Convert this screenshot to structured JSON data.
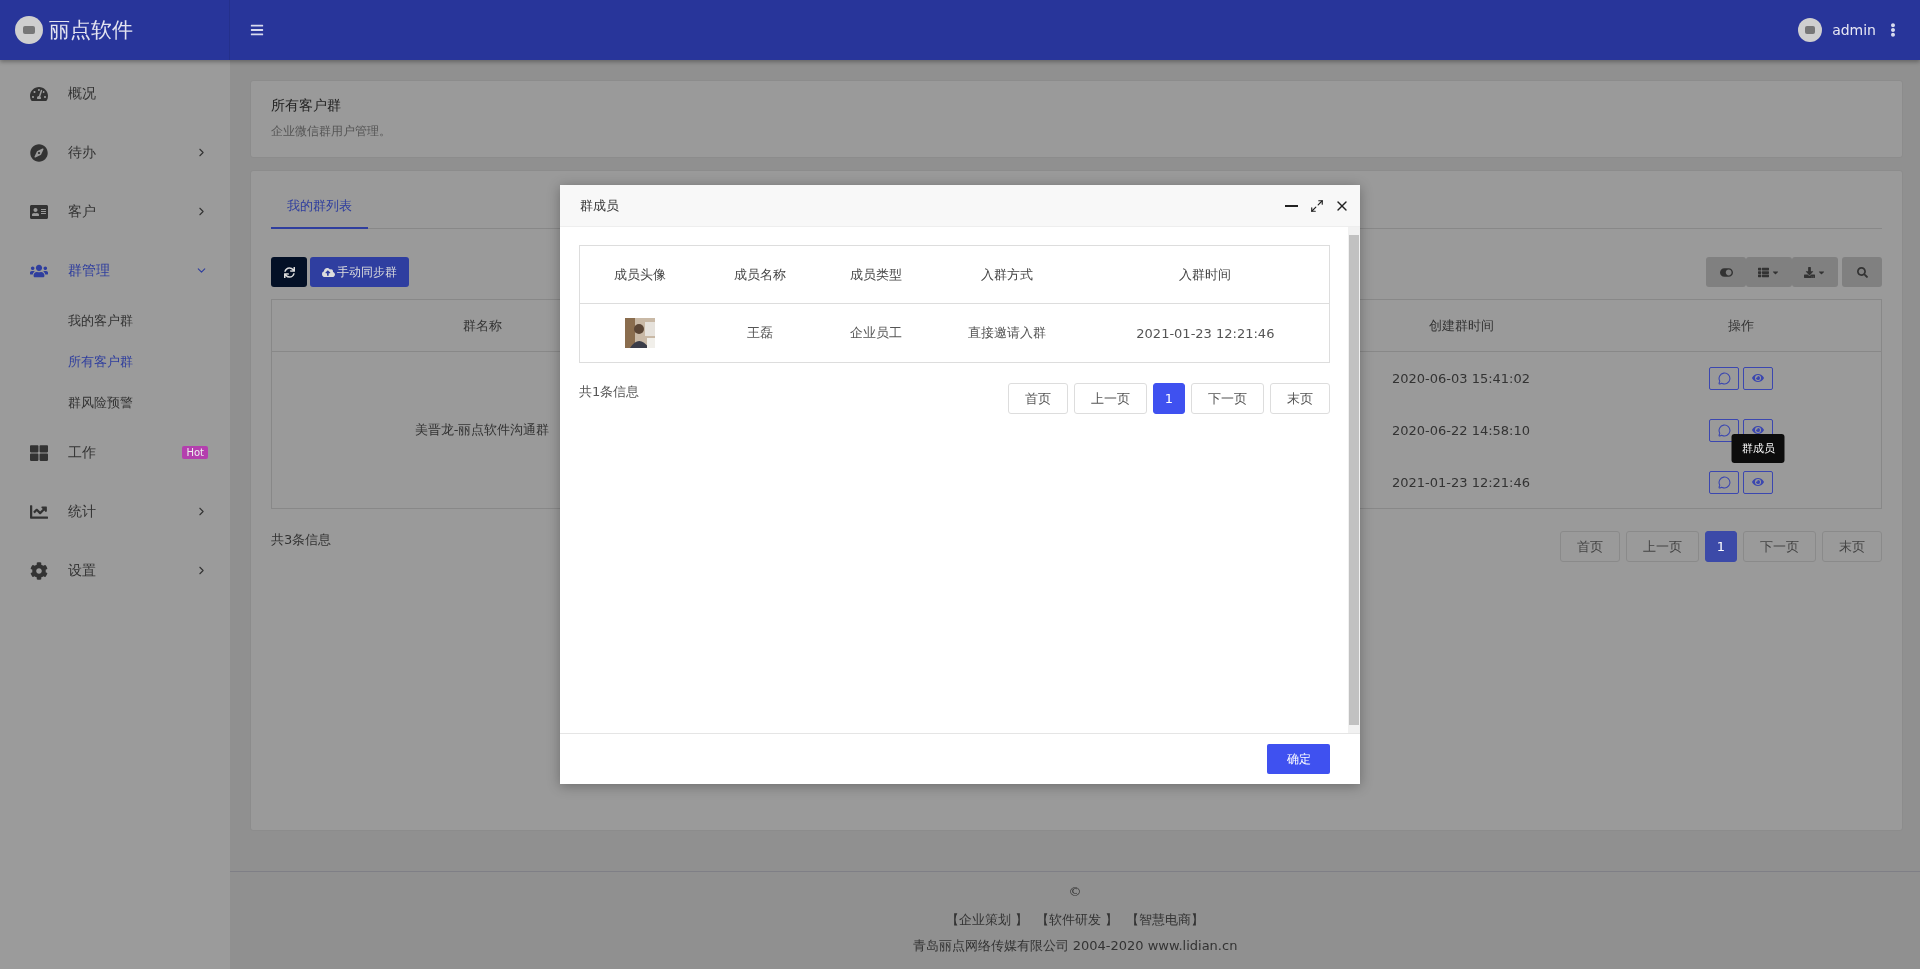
{
  "header": {
    "brand": "丽点软件",
    "user": "admin"
  },
  "sidebar": {
    "items": [
      {
        "label": "概况",
        "kind": "plain",
        "active": false
      },
      {
        "label": "待办",
        "kind": "submenu",
        "active": false,
        "expanded": false
      },
      {
        "label": "客户",
        "kind": "submenu",
        "active": false,
        "expanded": false
      },
      {
        "label": "群管理",
        "kind": "submenu",
        "active": true,
        "expanded": true,
        "children": [
          {
            "label": "我的客户群",
            "selected": false
          },
          {
            "label": "所有客户群",
            "selected": true
          },
          {
            "label": "群风险预警",
            "selected": false
          }
        ]
      },
      {
        "label": "工作",
        "kind": "badge",
        "active": false,
        "badge": "Hot"
      },
      {
        "label": "统计",
        "kind": "submenu",
        "active": false,
        "expanded": false
      },
      {
        "label": "设置",
        "kind": "submenu",
        "active": false,
        "expanded": false
      }
    ]
  },
  "page_header": {
    "title": "所有客户群",
    "subtitle": "企业微信群用户管理。"
  },
  "tabs": [
    {
      "label": "我的群列表",
      "selected": true
    }
  ],
  "toolbar": {
    "sync_button": "手动同步群"
  },
  "table": {
    "columns": [
      "群名称",
      "创建群时间",
      "操作"
    ],
    "group_name": "美晋龙-丽点软件沟通群",
    "rows": [
      {
        "created": "2020-06-03 15:41:02"
      },
      {
        "created": "2020-06-22 14:58:10"
      },
      {
        "created": "2021-01-23 12:21:46",
        "tooltip": "群成员"
      }
    ],
    "count": "共3条信息",
    "pagination": [
      {
        "label": "首页",
        "selected": false
      },
      {
        "label": "上一页",
        "selected": false
      },
      {
        "label": "1",
        "selected": true
      },
      {
        "label": "下一页",
        "selected": false
      },
      {
        "label": "末页",
        "selected": false
      }
    ]
  },
  "footer": {
    "copyright": "©",
    "links": [
      "【企业策划 】",
      "【软件研发 】",
      "【智慧电商】"
    ],
    "company": "青岛丽点网络传媒有限公司 2004-2020 www.lidian.cn"
  },
  "modal": {
    "title": "群成员",
    "columns": [
      "成员头像",
      "成员名称",
      "成员类型",
      "入群方式",
      "入群时间"
    ],
    "rows": [
      {
        "name": "王磊",
        "type": "企业员工",
        "join_method": "直接邀请入群",
        "join_time": "2021-01-23 12:21:46"
      }
    ],
    "count": "共1条信息",
    "pagination": [
      {
        "label": "首页",
        "selected": false
      },
      {
        "label": "上一页",
        "selected": false
      },
      {
        "label": "1",
        "selected": true
      },
      {
        "label": "下一页",
        "selected": false
      },
      {
        "label": "末页",
        "selected": false
      }
    ],
    "confirm": "确定"
  }
}
